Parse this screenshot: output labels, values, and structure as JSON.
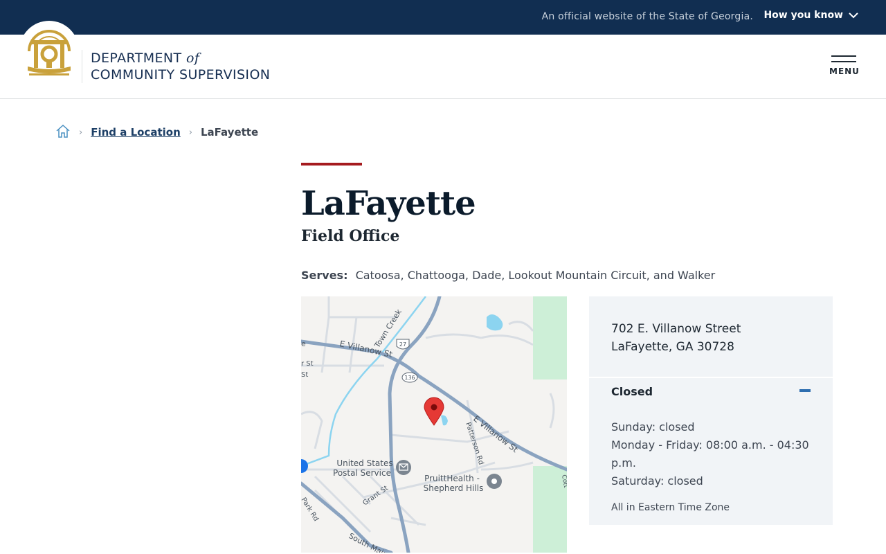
{
  "banner": {
    "official_text": "An official website of the State of Georgia.",
    "how_you_know": "How you know"
  },
  "header": {
    "logo_line1": "DEPARTMENT",
    "logo_of": "of",
    "logo_line2": "COMMUNITY SUPERVISION",
    "menu_label": "MENU"
  },
  "breadcrumb": {
    "link": "Find a Location",
    "current": "LaFayette"
  },
  "page": {
    "title": "LaFayette",
    "subtitle": "Field Office",
    "serves_label": "Serves:",
    "serves_value": "Catoosa, Chattooga, Dade, Lookout Mountain Circuit, and Walker"
  },
  "map": {
    "labels": {
      "town_creek": "Town Creek",
      "e_villanow_st_1": "E Villanow St",
      "e_villanow_st_2": "E Villanow St",
      "patterson_rd": "Patterson Rd",
      "grant_st": "Grant St",
      "south_main_st": "South Main St",
      "park_rd": "Park Rd",
      "st1": "r St",
      "st2": "St",
      "e_edge": "e",
      "cott": "Cott",
      "usps_line1": "United States",
      "usps_line2": "Postal Service",
      "pruitt_line1": "PruittHealth -",
      "pruitt_line2": "Shepherd Hills",
      "route_27": "27",
      "route_136": "136"
    }
  },
  "info": {
    "address_line1": "702 E. Villanow Street",
    "address_line2": "LaFayette, GA 30728",
    "status": "Closed",
    "hours": [
      "Sunday: closed",
      "Monday - Friday: 08:00 a.m. - 04:30 p.m.",
      "Saturday: closed"
    ],
    "timezone": "All in Eastern Time Zone"
  },
  "colors": {
    "banner_bg": "#112e51",
    "accent": "#a51b1f",
    "panel_bg": "#f1f4f7",
    "link": "#1d3f66",
    "gold": "#c9a13b"
  }
}
